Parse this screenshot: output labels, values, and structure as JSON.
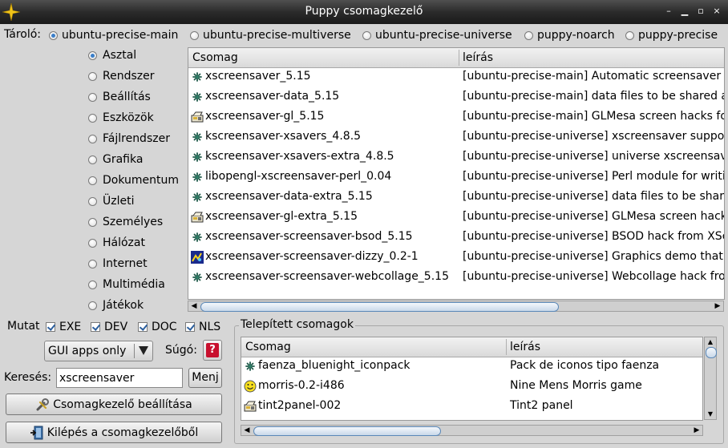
{
  "window": {
    "title": "Puppy csomagkezelő",
    "controls": [
      "–",
      "▁",
      "▫",
      "×"
    ]
  },
  "repo": {
    "label": "Tároló:",
    "options": [
      "ubuntu-precise-main",
      "ubuntu-precise-multiverse",
      "ubuntu-precise-universe",
      "puppy-noarch",
      "puppy-precise"
    ],
    "selected": "ubuntu-precise-main"
  },
  "categories": {
    "items": [
      "Asztal",
      "Rendszer",
      "Beállítás",
      "Eszközök",
      "Fájlrendszer",
      "Grafika",
      "Dokumentum",
      "Üzleti",
      "Személyes",
      "Hálózat",
      "Internet",
      "Multimédia",
      "Játékok"
    ],
    "selected": "Asztal"
  },
  "packages": {
    "col_name": "Csomag",
    "col_desc": "leírás",
    "rows": [
      {
        "name": "xscreensaver_5.15",
        "desc": "[ubuntu-precise-main] Automatic screensaver for X",
        "icon": "gear-icon"
      },
      {
        "name": "xscreensaver-data_5.15",
        "desc": "[ubuntu-precise-main] data files to be shared among screensaver frontends",
        "icon": "gear-icon"
      },
      {
        "name": "xscreensaver-gl_5.15",
        "desc": "[ubuntu-precise-main] GLMesa screen hacks for xscreensaver",
        "icon": "package-icon"
      },
      {
        "name": "kscreensaver-xsavers_4.8.5",
        "desc": "[ubuntu-precise-universe] xscreensaver support for KDE",
        "icon": "gear-icon"
      },
      {
        "name": "kscreensaver-xsavers-extra_4.8.5",
        "desc": "[ubuntu-precise-universe] universe xscreensavers for KDE",
        "icon": "gear-icon"
      },
      {
        "name": "libopengl-xscreensaver-perl_0.04",
        "desc": "[ubuntu-precise-universe] Perl module for writing OpenGL-based screensavers",
        "icon": "gear-icon"
      },
      {
        "name": "xscreensaver-data-extra_5.15",
        "desc": "[ubuntu-precise-universe] data files to be shared among screensaver frontends",
        "icon": "gear-icon"
      },
      {
        "name": "xscreensaver-gl-extra_5.15",
        "desc": "[ubuntu-precise-universe] GLMesa screen hacks for xscreensaver",
        "icon": "package-icon"
      },
      {
        "name": "xscreensaver-screensaver-bsod_5.15",
        "desc": "[ubuntu-precise-universe] BSOD hack from XScreenSaver",
        "icon": "gear-icon"
      },
      {
        "name": "xscreensaver-screensaver-dizzy_0.2-1",
        "desc": "[ubuntu-precise-universe] Graphics demo that makes you dizzy",
        "icon": "screen-icon"
      },
      {
        "name": "xscreensaver-screensaver-webcollage_5.15",
        "desc": "[ubuntu-precise-universe] Webcollage hack from XScreenSaver",
        "icon": "gear-icon"
      }
    ]
  },
  "show": {
    "label": "Mutat",
    "options": [
      {
        "label": "EXE",
        "checked": true
      },
      {
        "label": "DEV",
        "checked": true
      },
      {
        "label": "DOC",
        "checked": true
      },
      {
        "label": "NLS",
        "checked": true
      }
    ]
  },
  "filter": {
    "value": "GUI apps only"
  },
  "help": {
    "label": "Súgó:",
    "icon": "help-icon"
  },
  "search": {
    "label": "Keresés:",
    "value": "xscreensaver",
    "button": "Menj"
  },
  "buttons": {
    "settings": "Csomagkezelő beállítása",
    "quit": "Kilépés a csomagkezelőből"
  },
  "installed": {
    "title": "Telepített csomagok",
    "col_name": "Csomag",
    "col_desc": "leírás",
    "rows": [
      {
        "name": "faenza_bluenight_iconpack",
        "desc": "Pack de iconos tipo faenza",
        "icon": "gear-icon"
      },
      {
        "name": "morris-0.2-i486",
        "desc": "Nine Mens Morris game",
        "icon": "smiley-icon"
      },
      {
        "name": "tint2panel-002",
        "desc": "Tint2 panel",
        "icon": "package-icon"
      }
    ]
  }
}
